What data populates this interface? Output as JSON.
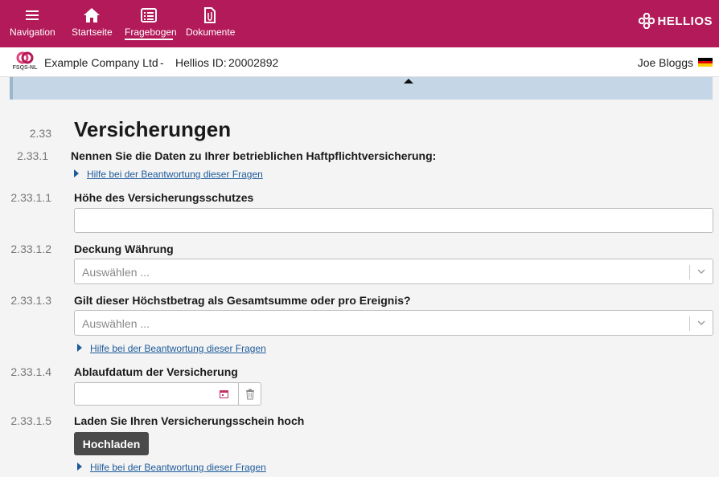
{
  "nav": {
    "items": [
      {
        "label": "Navigation",
        "icon": "hamburger-icon"
      },
      {
        "label": "Startseite",
        "icon": "home-icon"
      },
      {
        "label": "Fragebogen",
        "icon": "questionnaire-icon",
        "active": true
      },
      {
        "label": "Dokumente",
        "icon": "document-icon"
      }
    ],
    "brand": "HELLIOS"
  },
  "company": {
    "logo_text": "FSQS-NL",
    "name": "Example Company Ltd",
    "separator": "-",
    "id_label": "Hellios ID:",
    "id_value": "20002892",
    "user": "Joe Bloggs",
    "flag_colors": [
      "#000000",
      "#dd0000",
      "#ffce00"
    ]
  },
  "section": {
    "number": "2.33",
    "title": "Versicherungen"
  },
  "questions": {
    "q1": {
      "number": "2.33.1",
      "text": "Nennen Sie die Daten zu Ihrer betrieblichen Haftpflichtversicherung:",
      "help": "Hilfe bei der Beantwortung dieser Fragen"
    },
    "q11": {
      "number": "2.33.1.1",
      "text": "Höhe des Versicherungsschutzes",
      "value": ""
    },
    "q12": {
      "number": "2.33.1.2",
      "text": "Deckung Währung",
      "placeholder": "Auswählen ..."
    },
    "q13": {
      "number": "2.33.1.3",
      "text": "Gilt dieser Höchstbetrag als Gesamtsumme oder pro Ereignis?",
      "placeholder": "Auswählen ...",
      "help": "Hilfe bei der Beantwortung dieser Fragen"
    },
    "q14": {
      "number": "2.33.1.4",
      "text": "Ablaufdatum der Versicherung",
      "value": ""
    },
    "q15": {
      "number": "2.33.1.5",
      "text": "Laden Sie Ihren Versicherungsschein hoch",
      "button": "Hochladen",
      "help": "Hilfe bei der Beantwortung dieser Fragen"
    }
  },
  "colors": {
    "header": "#b31a59",
    "link": "#1d5a9a",
    "button": "#4a4a4a",
    "progress_strip": "#c5d7e6"
  }
}
